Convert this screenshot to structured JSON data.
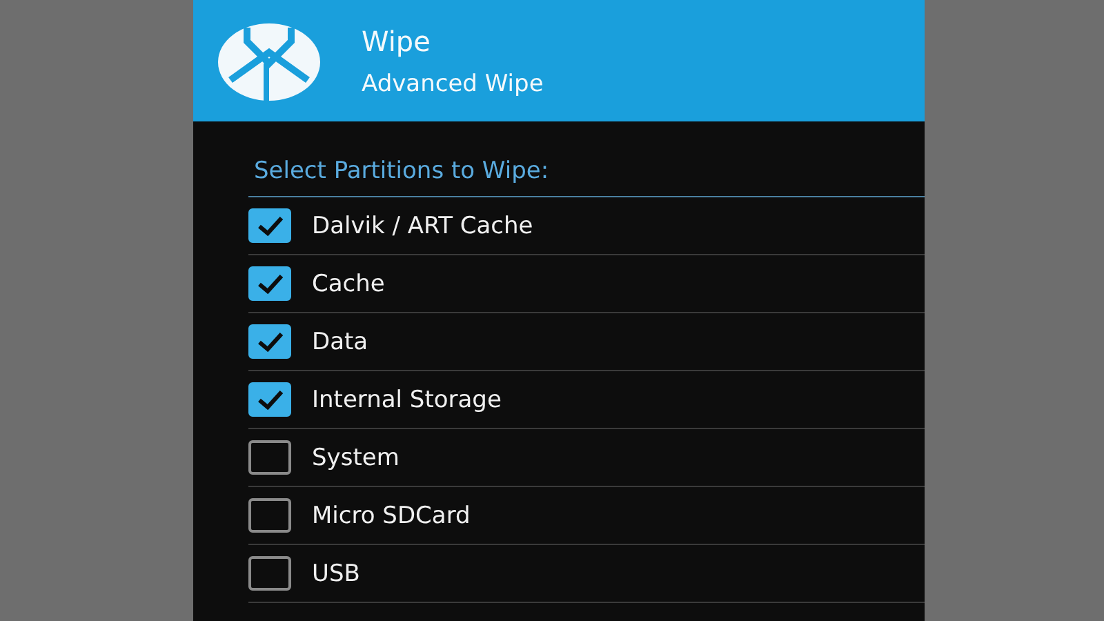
{
  "header": {
    "title": "Wipe",
    "subtitle": "Advanced Wipe"
  },
  "section": {
    "label": "Select Partitions to Wipe:"
  },
  "partitions": [
    {
      "label": "Dalvik / ART Cache",
      "checked": true
    },
    {
      "label": "Cache",
      "checked": true
    },
    {
      "label": "Data",
      "checked": true
    },
    {
      "label": "Internal Storage",
      "checked": true
    },
    {
      "label": "System",
      "checked": false
    },
    {
      "label": "Micro SDCard",
      "checked": false
    },
    {
      "label": "USB",
      "checked": false
    }
  ]
}
